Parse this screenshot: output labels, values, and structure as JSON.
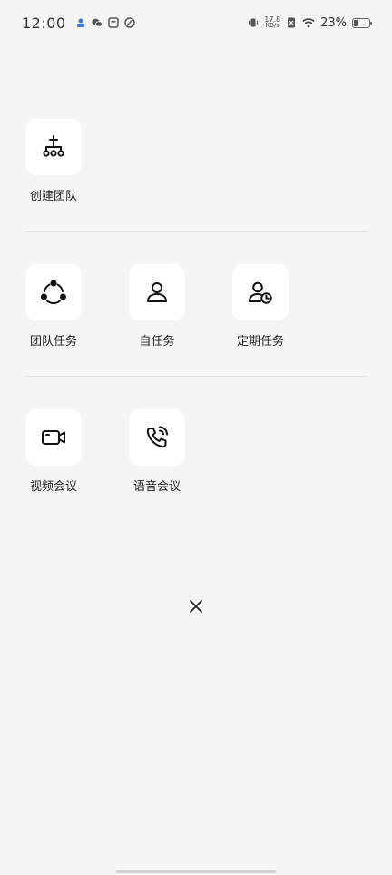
{
  "status_bar": {
    "time": "12:00",
    "net_speed_value": "17.8",
    "net_speed_unit": "KB/s",
    "battery_percent": "23%",
    "battery_level": 0.23
  },
  "sections": [
    {
      "items": [
        {
          "label": "创建团队",
          "icon": "create-team-icon"
        }
      ]
    },
    {
      "items": [
        {
          "label": "团队任务",
          "icon": "team-task-icon"
        },
        {
          "label": "自任务",
          "icon": "personal-task-icon"
        },
        {
          "label": "定期任务",
          "icon": "scheduled-task-icon"
        }
      ]
    },
    {
      "items": [
        {
          "label": "视频会议",
          "icon": "video-camera-icon"
        },
        {
          "label": "语音会议",
          "icon": "phone-call-icon"
        }
      ]
    }
  ],
  "close": {
    "icon": "close-icon"
  }
}
